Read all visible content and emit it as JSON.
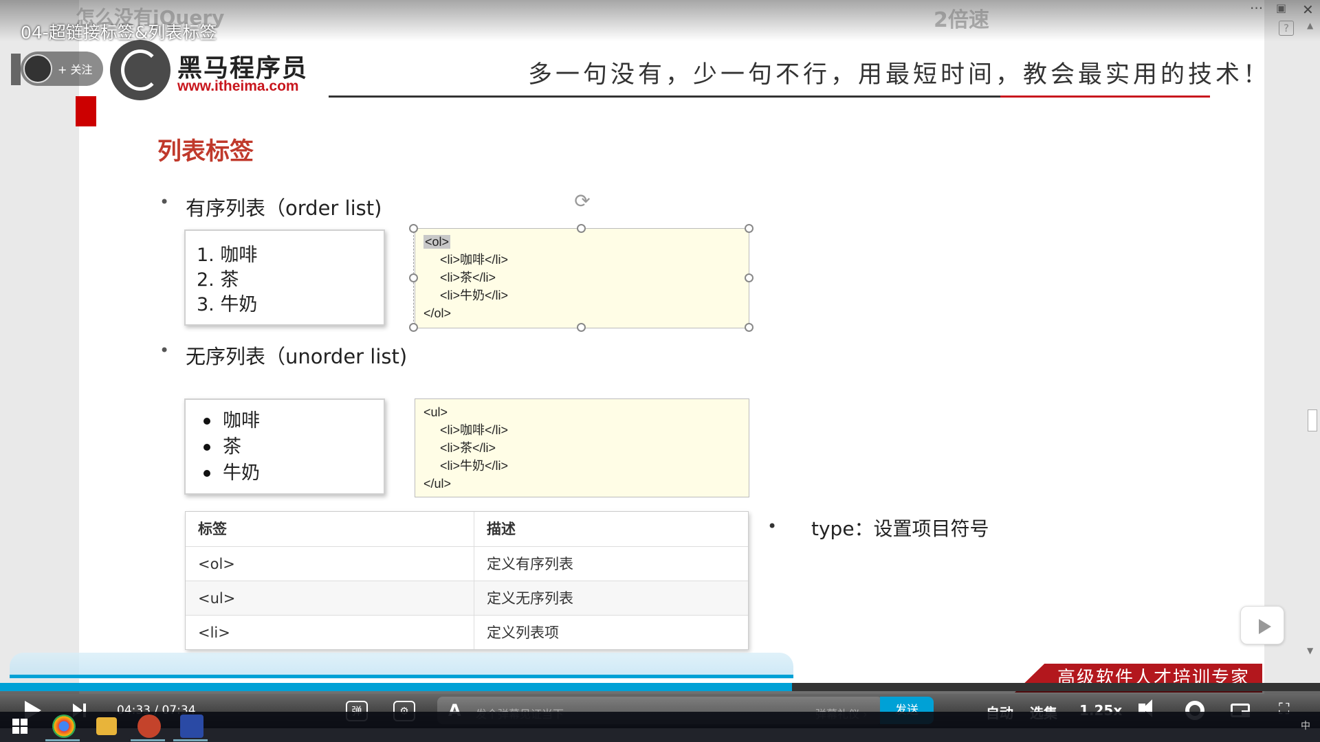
{
  "video": {
    "title": "04-超链接标签&列表标签",
    "watermark_left": "怎么没有jQuery",
    "watermark_speed": "2倍速",
    "follow_label": "+ 关注"
  },
  "slide": {
    "brand_name": "黑马程序员",
    "brand_url": "www.itheima.com",
    "slogan": "多一句没有，少一句不行，用最短时间，教会最实用的技术！",
    "title": "列表标签",
    "bullet_ol": "有序列表（order list)",
    "bullet_ul": "无序列表（unorder list)",
    "ol_items": [
      "1. 咖啡",
      "2. 茶",
      "3. 牛奶"
    ],
    "ul_items": [
      "咖啡",
      "茶",
      "牛奶"
    ],
    "ol_code": {
      "open": "<ol>",
      "lines": [
        "<li>咖啡</li>",
        "<li>茶</li>",
        "<li>牛奶</li>"
      ],
      "close": "</ol>"
    },
    "ul_code": {
      "open": "<ul>",
      "lines": [
        "<li>咖啡</li>",
        "<li>茶</li>",
        "<li>牛奶</li>"
      ],
      "close": "</ul>"
    },
    "table": {
      "headers": [
        "标签",
        "描述"
      ],
      "rows": [
        [
          "<ol>",
          "定义有序列表"
        ],
        [
          "<ul>",
          "定义无序列表"
        ],
        [
          "<li>",
          "定义列表项"
        ]
      ]
    },
    "type_note": "type：设置项目符号",
    "ribbon": "高级软件人才培训专家"
  },
  "player": {
    "current_time": "04:33",
    "total_time": "07:34",
    "progress": 0.6,
    "danmaku_placeholder": "发个弹幕见证当下",
    "danmaku_etiquette": "弹幕礼仪 ›",
    "send_label": "发送",
    "auto_label": "自动",
    "episodes_label": "选集",
    "speed_label": "1.25x",
    "danmaku_toggle_icon": "弹",
    "danmaku_settings_icon": "⚙"
  },
  "taskbar": {
    "ime": "中"
  },
  "colors": {
    "accent": "#00a1d6",
    "title_red": "#c0392b",
    "brand_red": "#c8161d",
    "code_bg": "#fffde6"
  }
}
